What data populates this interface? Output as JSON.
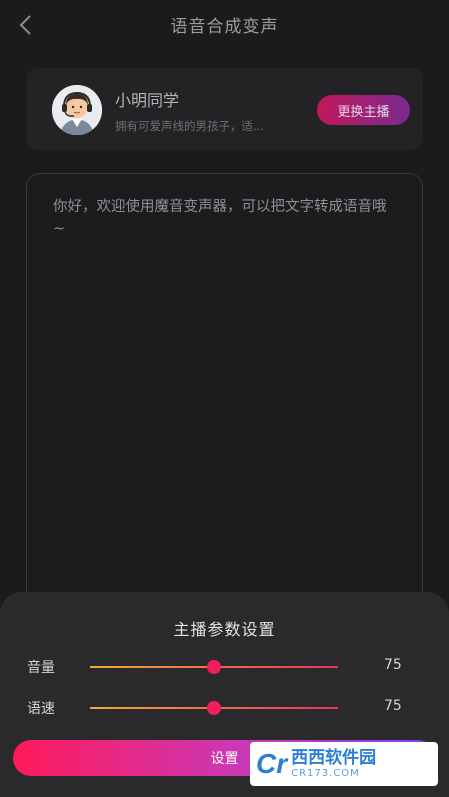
{
  "header": {
    "title": "语音合成变声",
    "back_icon": "chevron-left-icon"
  },
  "anchor": {
    "name": "小明同学",
    "description": "拥有可爱声线的男孩子，适...",
    "switch_label": "更换主播",
    "avatar_icon": "headset-boy-avatar"
  },
  "editor": {
    "text": "你好，欢迎使用魔音变声器，可以把文字转成语音哦~"
  },
  "settings": {
    "title": "主播参数设置",
    "volume": {
      "label": "音量",
      "value": "75",
      "fraction": 0.5
    },
    "speed": {
      "label": "语速",
      "value": "75",
      "fraction": 0.5
    },
    "submit_label": "设置"
  },
  "watermark": {
    "logo": "Cr",
    "name": "西西软件园",
    "url": "CR173.COM"
  },
  "colors": {
    "accent": "#f01e5a",
    "gradient_start": "#ff1a5a",
    "gradient_end": "#7d3ef0"
  }
}
